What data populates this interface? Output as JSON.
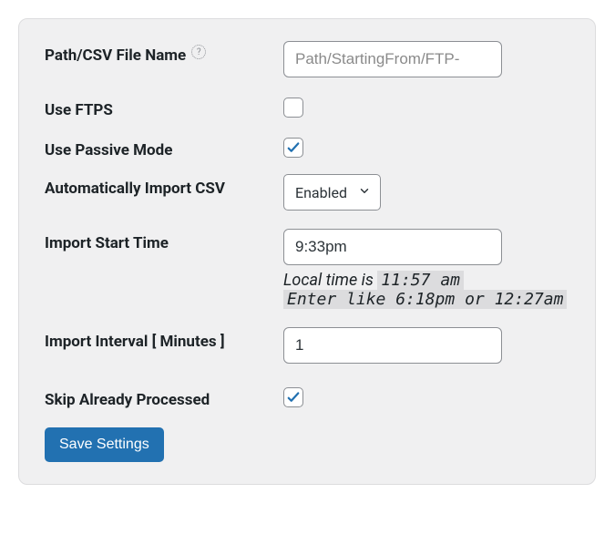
{
  "fields": {
    "path": {
      "label": "Path/CSV File Name",
      "placeholder": "Path/StartingFrom/FTP-",
      "value": ""
    },
    "ftps": {
      "label": "Use FTPS",
      "checked": false
    },
    "passive": {
      "label": "Use Passive Mode",
      "checked": true
    },
    "auto_import": {
      "label": "Automatically Import CSV",
      "selected": "Enabled"
    },
    "start_time": {
      "label": "Import Start Time",
      "value": "9:33pm",
      "hint_prefix": "Local time is ",
      "hint_time": "11:57 am",
      "hint_example": "Enter like 6:18pm or 12:27am"
    },
    "interval": {
      "label": "Import Interval [ Minutes ]",
      "value": "1"
    },
    "skip_processed": {
      "label": "Skip Already Processed",
      "checked": true
    }
  },
  "buttons": {
    "save": "Save Settings"
  },
  "icons": {
    "help": "?"
  },
  "colors": {
    "accent": "#2271b1",
    "panel_bg": "#f0f0f1",
    "border": "#8c8f94"
  }
}
